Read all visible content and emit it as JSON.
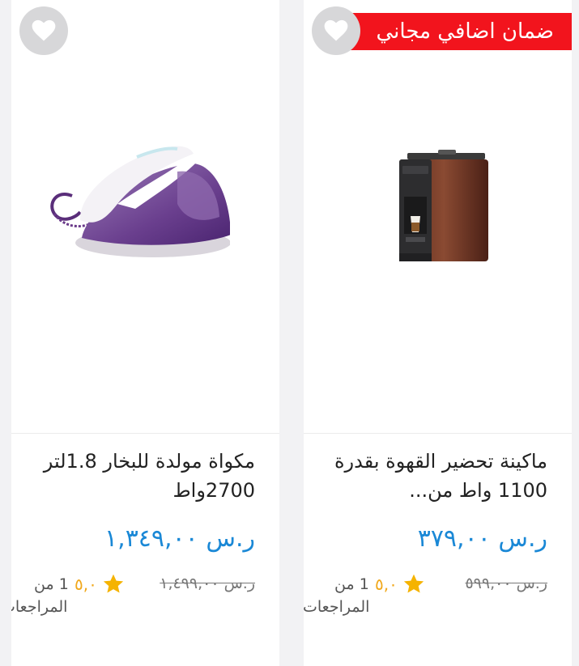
{
  "products": [
    {
      "badge": "ضمان اضافي مجاني",
      "title": "ماكينة تحضير القهوة بقدرة 1100 واط من...",
      "price": "ر.س ٣٧٩,٠٠",
      "old_price": "ر.س ٥٩٩,٠٠",
      "rating": "٥,٠",
      "reviews_line1": "1 من",
      "reviews_line2": "المراجعات",
      "image": "coffee-machine",
      "icons": {
        "favorite": "heart-icon",
        "rating": "star-icon"
      }
    },
    {
      "title": "مكواة مولدة للبخار 1.8لتر 2700واط",
      "price": "ر.س ١,٣٤٩,٠٠",
      "old_price": "ر.س ١,٤٩٩,٠٠",
      "rating": "٥,٠",
      "reviews_line1": "1 من",
      "reviews_line2": "المراجعات",
      "image": "steam-iron",
      "icons": {
        "favorite": "heart-icon",
        "rating": "star-icon"
      }
    }
  ],
  "colors": {
    "badge": "#f2141d",
    "price": "#1a88d6",
    "star": "#f5b301",
    "heart_bg": "#d7d7d9"
  }
}
